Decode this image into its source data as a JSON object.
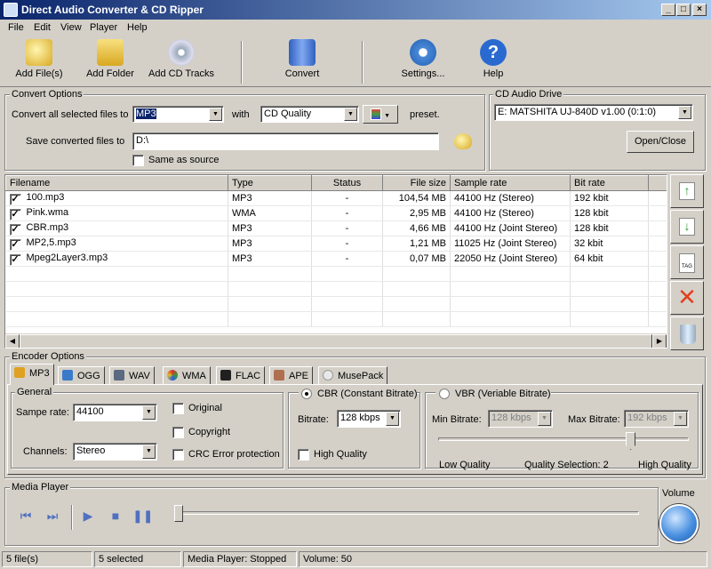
{
  "title": "Direct Audio Converter & CD Ripper",
  "menu": [
    "File",
    "Edit",
    "View",
    "Player",
    "Help"
  ],
  "toolbar": {
    "add_files": "Add File(s)",
    "add_folder": "Add Folder",
    "add_cd": "Add CD Tracks",
    "convert": "Convert",
    "settings": "Settings...",
    "help": "Help"
  },
  "convert": {
    "group": "Convert Options",
    "convert_label": "Convert all selected files to",
    "format": "MP3",
    "with": "with",
    "quality": "CD Quality",
    "preset": "preset.",
    "save_label": "Save converted files to",
    "path": "D:\\",
    "same_as_source": "Same as source"
  },
  "cd": {
    "group": "CD Audio Drive",
    "drive": "E: MATSHITA UJ-840D v1.00 (0:1:0)",
    "open_close": "Open/Close"
  },
  "files": {
    "headers": [
      "Filename",
      "Type",
      "Status",
      "File size",
      "Sample rate",
      "Bit rate"
    ],
    "rows": [
      [
        "100.mp3",
        "MP3",
        "-",
        "104,54 MB",
        "44100 Hz (Stereo)",
        "192 kbit"
      ],
      [
        "Pink.wma",
        "WMA",
        "-",
        "2,95 MB",
        "44100 Hz (Stereo)",
        "128 kbit"
      ],
      [
        "CBR.mp3",
        "MP3",
        "-",
        "4,66 MB",
        "44100 Hz (Joint Stereo)",
        "128 kbit"
      ],
      [
        "MP2,5.mp3",
        "MP3",
        "-",
        "1,21 MB",
        "11025 Hz (Joint Stereo)",
        "32 kbit"
      ],
      [
        "Mpeg2Layer3.mp3",
        "MP3",
        "-",
        "0,07 MB",
        "22050 Hz (Joint Stereo)",
        "64 kbit"
      ]
    ]
  },
  "encoder": {
    "group": "Encoder Options",
    "tabs": [
      "MP3",
      "OGG",
      "WAV",
      "WMA",
      "FLAC",
      "APE",
      "MusePack"
    ],
    "general": "General",
    "sample_rate_label": "Sampe rate:",
    "sample_rate": "44100",
    "channels_label": "Channels:",
    "channels": "Stereo",
    "original": "Original",
    "copyright": "Copyright",
    "crc": "CRC Error protection",
    "cbr": "CBR (Constant Bitrate)",
    "bitrate_label": "Bitrate:",
    "bitrate": "128 kbps",
    "high_quality": "High Quality",
    "vbr": "VBR (Veriable Bitrate)",
    "min_label": "Min Bitrate:",
    "min": "128 kbps",
    "max_label": "Max Bitrate:",
    "max": "192 kbps",
    "low_quality": "Low Quality",
    "quality_selection": "Quality Selection:  2",
    "high_quality_label": "High Quality"
  },
  "player": {
    "group": "Media Player",
    "volume": "Volume"
  },
  "status": {
    "files": "5 file(s)",
    "selected": "5 selected",
    "player": "Media Player: Stopped",
    "volume": "Volume: 50"
  }
}
